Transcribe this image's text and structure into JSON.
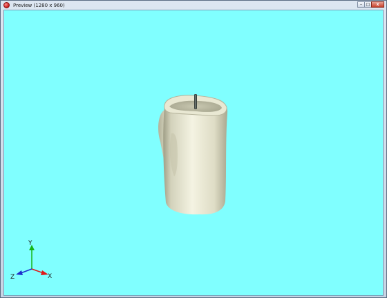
{
  "window": {
    "title": "Preview (1280 x 960)",
    "controls": {
      "minimize_glyph": "–",
      "maximize_glyph": "□",
      "close_glyph": "x"
    }
  },
  "viewport": {
    "background": "#80ffff",
    "model_color": "#ecebd7",
    "axes": {
      "y_label": "Y",
      "x_label": "X",
      "z_label": "Z",
      "y_color": "#16b616",
      "x_color": "#e01818",
      "z_color": "#1f2ecc"
    }
  }
}
